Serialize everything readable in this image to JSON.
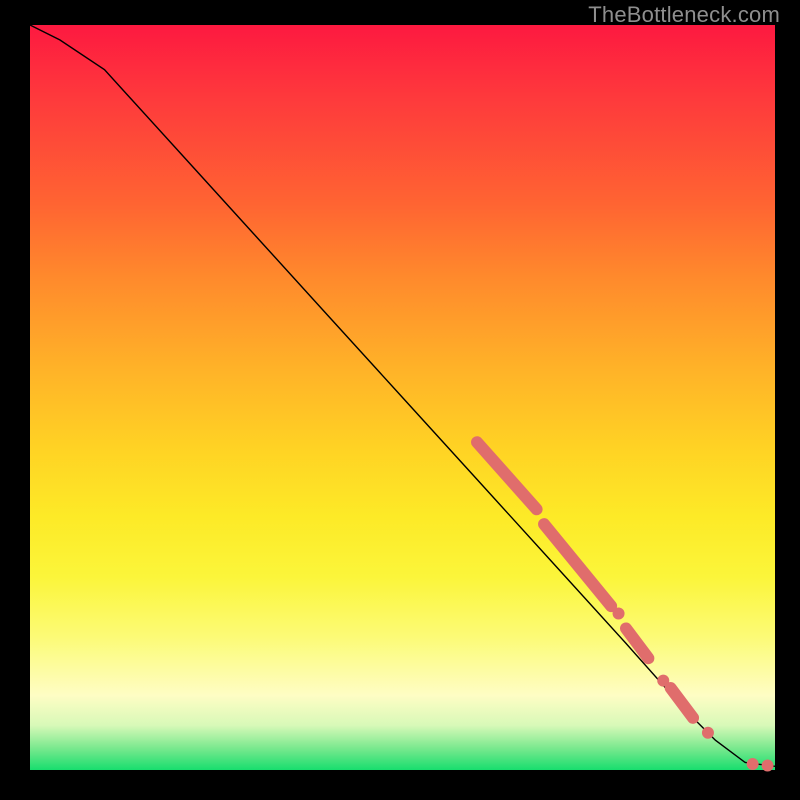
{
  "watermark": "TheBottleneck.com",
  "chart_data": {
    "type": "line",
    "title": "",
    "xlabel": "",
    "ylabel": "",
    "xlim": [
      0,
      100
    ],
    "ylim": [
      0,
      100
    ],
    "grid": false,
    "legend": false,
    "series": [
      {
        "name": "curve",
        "style": "line",
        "color": "#000000",
        "x": [
          0,
          4,
          10,
          20,
          30,
          40,
          50,
          60,
          70,
          80,
          88,
          92,
          96,
          100
        ],
        "y": [
          100,
          98,
          94,
          83,
          72,
          61,
          50,
          39,
          28,
          17,
          8,
          4,
          1,
          0.5
        ]
      },
      {
        "name": "highlighted-markers",
        "style": "scatter",
        "color": "#e06d6c",
        "points": [
          {
            "x": 60,
            "y": 44,
            "kind": "segment_start"
          },
          {
            "x": 68,
            "y": 35,
            "kind": "segment_end"
          },
          {
            "x": 69,
            "y": 33,
            "kind": "segment_start"
          },
          {
            "x": 78,
            "y": 22,
            "kind": "segment_end"
          },
          {
            "x": 79,
            "y": 21,
            "kind": "dot"
          },
          {
            "x": 80,
            "y": 19,
            "kind": "segment_start"
          },
          {
            "x": 83,
            "y": 15,
            "kind": "segment_end"
          },
          {
            "x": 85,
            "y": 12,
            "kind": "dot"
          },
          {
            "x": 86,
            "y": 11,
            "kind": "segment_start"
          },
          {
            "x": 89,
            "y": 7,
            "kind": "segment_end"
          },
          {
            "x": 91,
            "y": 5,
            "kind": "dot"
          },
          {
            "x": 97,
            "y": 0.8,
            "kind": "dot"
          },
          {
            "x": 99,
            "y": 0.6,
            "kind": "dot"
          }
        ]
      }
    ],
    "background_gradient": {
      "direction": "vertical",
      "stops": [
        {
          "pos": 0.0,
          "color": "#fd1940"
        },
        {
          "pos": 0.1,
          "color": "#fe3a3c"
        },
        {
          "pos": 0.24,
          "color": "#ff6432"
        },
        {
          "pos": 0.34,
          "color": "#ff8a2c"
        },
        {
          "pos": 0.46,
          "color": "#ffb228"
        },
        {
          "pos": 0.57,
          "color": "#ffd324"
        },
        {
          "pos": 0.66,
          "color": "#fdea27"
        },
        {
          "pos": 0.74,
          "color": "#fbf53a"
        },
        {
          "pos": 0.82,
          "color": "#fcfb75"
        },
        {
          "pos": 0.9,
          "color": "#fefdc4"
        },
        {
          "pos": 0.94,
          "color": "#d8f9b8"
        },
        {
          "pos": 0.97,
          "color": "#7ce98f"
        },
        {
          "pos": 1.0,
          "color": "#18de6e"
        }
      ]
    }
  }
}
